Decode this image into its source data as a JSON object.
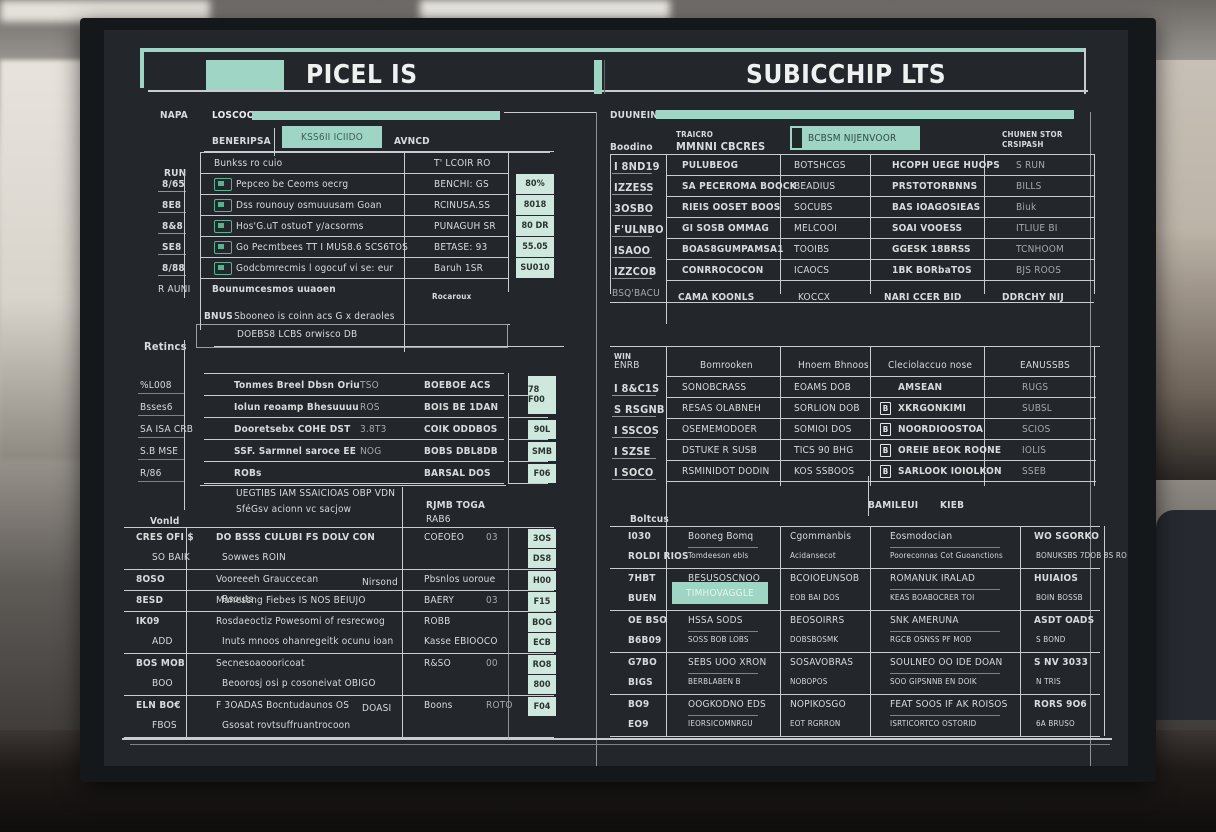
{
  "colors": {
    "accent": "#9fd5c4",
    "panel": "#23272b",
    "text": "#d7dbdc",
    "cell": "#cfe8de"
  },
  "left_panel": {
    "title": "PICEL IS",
    "sub_label": "NAPA",
    "progress_label": "LOSCOO",
    "tab_label": "BENERIPSA",
    "search_value": "KSS6II ICIIDO",
    "aux_label": "AVNCD",
    "table1": {
      "headers": [
        "RUN",
        "Bunkss ro cuio",
        "T' LCOIR RO"
      ],
      "rows": [
        {
          "side": "8/65",
          "desc": "Pepceo be Ceoms oecrg",
          "val": "BENCHI: GS",
          "badge": "80%"
        },
        {
          "side": "8E8",
          "desc": "Dss rounouy osmuuusam Goan",
          "val": "RCINUSA.SS",
          "badge": "8018"
        },
        {
          "side": "8&8",
          "desc": "Hos'G.uT ostuoT y/acsorms",
          "val": "PUNAGUH SR",
          "badge": "80 DR"
        },
        {
          "side": "SE8",
          "desc": "Go Pecmtbees TT I MUS8.6 SCS6TOS",
          "val": "BETASE: 93",
          "badge": "55.05"
        },
        {
          "side": "8/88",
          "desc": "Godcbmrecmis l ogocuf vi se: eur",
          "val": "Baruh 1SR",
          "badge": "SU010"
        }
      ],
      "footer_side": "R AUNI",
      "footer_desc": "Bounumcesmos uuaoen",
      "footer_val": "Rocaroux"
    },
    "summary_line": "Sbooneo is coinn acs G x deraoles",
    "summary_prefix": "BNUS",
    "summary_input": "DOEBS8 LCBS orwisco DB",
    "table2": {
      "section": "Retincs",
      "rows": [
        {
          "side": "%L008",
          "desc": "Tonmes Breel Dbsn Oriu",
          "num": "TSO",
          "val": "BOEBOE ACS",
          "badge": "78 F00"
        },
        {
          "side": "Bsses6",
          "desc": "Iolun reoamp Bhesuuuu",
          "num": "ROS",
          "val": "BOIS BE 1DAN",
          "badge": ""
        },
        {
          "side": "SA ISA CRB",
          "desc": "Dooretsebx COHE DST",
          "num": "3.8T3",
          "val": "COIK ODDBOS",
          "badge": "90L"
        },
        {
          "side": "S.B MSE",
          "desc": "SSF. Sarmnel saroce EE",
          "num": "NOG",
          "val": "BOBS DBL8DB",
          "badge": "SMB"
        },
        {
          "side": "R/86",
          "desc": "ROBs",
          "num": "",
          "val": "BARSAL DOS",
          "badge": "F06"
        }
      ]
    },
    "note1": "UEGTIBS IAM SSAICIOAS OBP VDN",
    "note2": "SféGsv acionn vc sacjow",
    "table3": {
      "section": "Vonld",
      "col_head": "RJMB TOGA",
      "col_sub": "RAB6",
      "rows": [
        {
          "side": "CRES OFI $",
          "side2": "SO BAIK",
          "desc": "DO BSSS CULUBI FS DOLV CON",
          "desc2": "Sowwes ROIN",
          "val": "COEOEO",
          "val_sub": "03",
          "badge": "3OS",
          "badge2": "DS8"
        },
        {
          "side": "8OSO",
          "side2": "",
          "desc": "Vooreeeh Grauccecan",
          "desc2": "Rsouts",
          "tag": "Nirsond",
          "val": "Pbsnlos uoroue",
          "badge": "H00"
        },
        {
          "side": "8ESD",
          "side2": "",
          "desc": "Manessng Fiebes IS NOS BEIUJO",
          "val": "BAERY",
          "val_sub": "03",
          "badge": "F15"
        },
        {
          "side": "IK09",
          "side2": "ADD",
          "desc": "Rosdaeoctiz Powesomi of resrecwog",
          "desc2": "Inuts mnoos ohanregeitk ocunu ioan",
          "val": "ROBB",
          "val2": "Kasse EBIOOCO",
          "badge": "BOG",
          "badge2": "ECB"
        },
        {
          "side": "BOS MOB",
          "side2": "BOO",
          "desc": "Secnesoaoooricoat",
          "desc2": "Beoorosj osi p cosoneivat OBIGO",
          "val": "R&SO",
          "val_sub": "00",
          "badge": "RO8",
          "badge2": "800"
        },
        {
          "side": "ELN BO€",
          "side2": "FBOS",
          "desc": "F 3OADAS Bocntudaunos OS",
          "desc2": "Gsosat rovtsuffruantrocoon",
          "tag": "DOASI",
          "val": "Boons",
          "val_sub": "ROTO",
          "badge": "F04",
          "badge2": ""
        }
      ]
    }
  },
  "right_panel": {
    "title": "SUBICCHIP LTS",
    "progress_label": "DUUNEIN",
    "search_value": "BCBSM NIJENVOOR",
    "header_left": "Boodino",
    "header_top": "TRAICRO",
    "header_main": "MMNNI CBCRES",
    "header_right": "CHUNEN STOR",
    "header_right2": "CRSIPASH",
    "table1": {
      "rows": [
        {
          "id": "I 8ND19",
          "c1": "PULUBEOG",
          "c2": "BOTSHCGS",
          "c3": "HCOPH UEGE HUOPS",
          "c4": "S RUN"
        },
        {
          "id": "IZZESS",
          "c1": "SA PECEROMA BOOCK",
          "c2": "BEADIUS",
          "c3": "PRSTOTORBNNS",
          "c4": "BILLS"
        },
        {
          "id": "3OSBO",
          "c1": "RIEIS OOSET BOOS",
          "c2": "SOCUBS",
          "c3": "BAS IOAGOSIEAS",
          "c4": "Biuk"
        },
        {
          "id": "F'ULNBO",
          "c1": "GI SOSB OMMAG",
          "c2": "MELCOOI",
          "c3": "SOAI VOOESS",
          "c4": "ITLIUE BI"
        },
        {
          "id": "ISAOO",
          "c1": "BOAS8GUMPAMSA1",
          "c2": "TOOIBS",
          "c3": "GGESK 18BRSS",
          "c4": "TCNHOOM"
        },
        {
          "id": "IZZCOB",
          "c1": "CONRROCOCON",
          "c2": "ICAOCS",
          "c3": "1BK BORbaTOS",
          "c4": "BJS ROOS"
        }
      ],
      "footer": {
        "id": "BSQ'BACU",
        "c1": "CAMA KOONLS",
        "c2": "KOCCX",
        "c3": "NARI CCER BID",
        "c4": "DDRCHY NIJ"
      }
    },
    "table2": {
      "headers": [
        "WIN ENRB",
        "Bomrooken",
        "Hnoem Bhnoos",
        "Cleciolaccuo nose",
        "EANUSSBS"
      ],
      "rows": [
        {
          "id": "I 8&C1S",
          "c1": "SONOBCRASS",
          "c2": "EOAMS DOB",
          "c3": "AMSEAN",
          "c4": "RUGS"
        },
        {
          "id": "S RSGNB",
          "c1": "RESAS OLABNEH",
          "c2": "SORLION DOB",
          "c3": "XKRGONKIMI",
          "c4": "SUBSL"
        },
        {
          "id": "I SSCOS",
          "c1": "OSEMEMODOER",
          "c2": "SOMIOI DOS",
          "c3": "NOORDIOOSTOA",
          "c4": "SCIOS"
        },
        {
          "id": "I SZSE",
          "c1": "DSTUKE R SUSB",
          "c2": "TICS 90 BHG",
          "c3": "OREIE BEOK ROONE",
          "c4": "IOLIS"
        },
        {
          "id": "I SOCO",
          "c1": "RSMINIDOT DODIN",
          "c2": "KOS SSBOOS",
          "c3": "SARLOOK IOIOLKON",
          "c4": "SSEB"
        }
      ]
    },
    "section3_title": "BAMILEUI",
    "section3_code": "KIEB",
    "table3": {
      "section": "Boltcus",
      "highlight": "TIMHOVAGGLE",
      "rows": [
        {
          "id": "I030",
          "id2": "ROLDI RIOS",
          "c1": "Booneg Bomq",
          "c1b": "Tomdeeson ebls",
          "c2": "Cgommanbis",
          "c2b": "Acidansecot",
          "c3": "Eosmodocian",
          "c3b": "Pooreconnas Cot Guoanctions",
          "c4": "WO SGORKO",
          "c4b": "BONUKSBS 7DOB 8S RO"
        },
        {
          "id": "7HBT",
          "id2": "BUEN",
          "c1": "BESUSOSCNOO",
          "c1b": "",
          "c2": "BCOIOEUNSOB",
          "c2b": "EOB BAI DOS",
          "c3": "ROMANUK IRALAD",
          "c3b": "KEAS BOABOCRER TOI",
          "c4": "HUIAIOS",
          "c4b": "BOIN BOSSB"
        },
        {
          "id": "OE BSO",
          "id2": "B6B09",
          "c1": "HSSA SODS",
          "c1b": "SOSS BOB LOBS",
          "c2": "BEOSOIRRS",
          "c2b": "DOBSBOSMK",
          "c3": "SNK AMERUNA",
          "c3b": "RGCB OSNSS PF MOD",
          "c4": "ASDT OADS",
          "c4b": "S BOND"
        },
        {
          "id": "G7BO",
          "id2": "BIGS",
          "c1": "SEBS UOO XRON",
          "c1b": "BERBLABEN B",
          "c2": "SOSAVOBRAS",
          "c2b": "NOBOPOS",
          "c3": "SOULNEO OO IDE DOAN",
          "c3b": "SOO GIPSNNB EN DOIK",
          "c4": "S NV 3033",
          "c4b": "N TRIS"
        },
        {
          "id": "BO9",
          "id2": "EO9",
          "c1": "OOGKODNO EDS",
          "c1b": "IEORSICOMNRGU",
          "c2": "NOPIKOSGO",
          "c2b": "EOT RGRRON",
          "c3": "FEAT SOOS IF AK ROISOS",
          "c3b": "ISRTICORTCO OSTORID",
          "c4": "RORS 9O6",
          "c4b": "6A BRUSO"
        }
      ]
    }
  }
}
